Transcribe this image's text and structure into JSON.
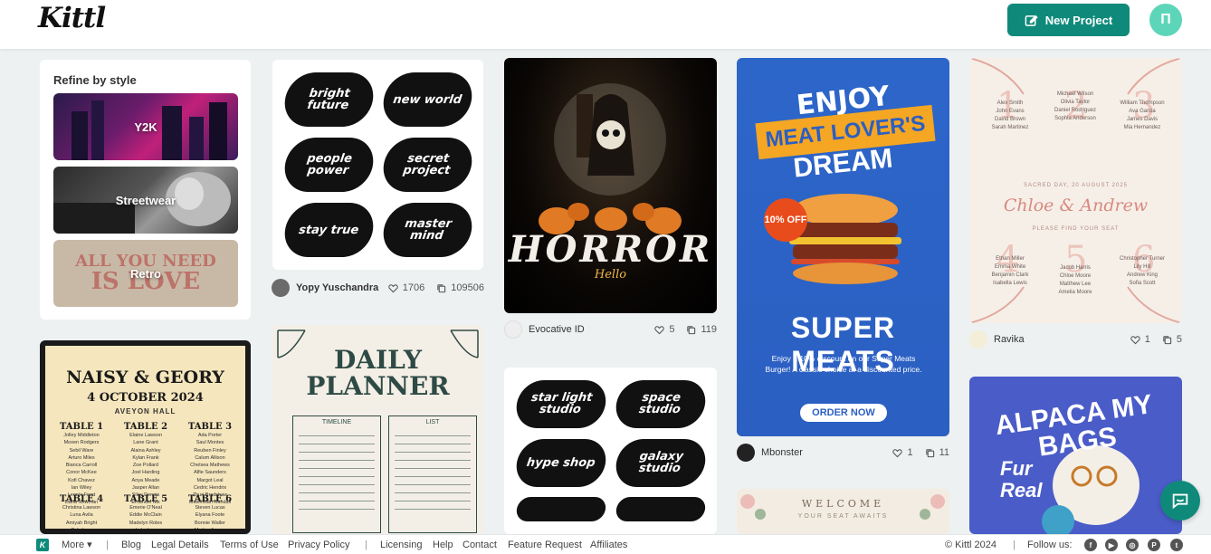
{
  "header": {
    "logo": "Kittl",
    "new_project_label": "New Project",
    "avatar_initial": "П"
  },
  "refine": {
    "title": "Refine by style",
    "styles": [
      {
        "label": "Y2K"
      },
      {
        "label": "Streetwear"
      },
      {
        "label": "Retro"
      }
    ],
    "retro_art_text": [
      "ALL YOU NEED",
      "IS LOVE"
    ]
  },
  "cards": {
    "bright_future": {
      "tiles": [
        "bright future",
        "new world",
        "people power",
        "secret project",
        "stay true",
        "master mind"
      ],
      "author": "Yopy Yuschandra",
      "likes": "1706",
      "copies": "109506"
    },
    "horror": {
      "title": "HORROR",
      "subtitle": "Hello",
      "author": "Evocative ID",
      "likes": "5",
      "copies": "119"
    },
    "meat": {
      "line1": "ENJOY",
      "line2": "MEAT LOVER'S",
      "line3": "DREAM",
      "badge": "10% OFF",
      "super": "SUPER MEATS",
      "desc": "Enjoy a 10% discount on our Super Meats Burger! A classic choice at a discounted price.",
      "button": "ORDER NOW",
      "author": "Mbonster",
      "likes": "1",
      "copies": "11"
    },
    "wedding": {
      "date": "SACRED DAY, 20 AUGUST 2025",
      "names": "Chloe & Andrew",
      "find": "PLEASE FIND YOUR SEAT",
      "nums": [
        "1",
        "2",
        "3",
        "4",
        "5",
        "6"
      ],
      "lists": [
        "Alex Smith\nJohn Evans\nDavid Brown\nSarah Martinez",
        "Michael Wilson\nOlivia Taylor\nDaniel Rodriguez\nSophia Anderson",
        "William Thompson\nAva Garcia\nJames Davis\nMia Hernandez",
        "Ethan Miller\nEmma White\nBenjamin Clark\nIsabella Lewis",
        "Jacob Harris\nChloe Moore\nMatthew Lee\nAmelia Moore",
        "Christopher Turner\nLily Hill\nAndrew King\nSofia Scott"
      ],
      "author": "Ravika",
      "likes": "1",
      "copies": "5"
    },
    "alpaca": {
      "title": "ALPACA MY BAGS",
      "fur": "Fur\nReal"
    },
    "naisy": {
      "title": "NAISY & GEORY",
      "date": "4 OCTOBER 2024",
      "hall": "AVEYON HALL",
      "tables": [
        {
          "t": "TABLE 1",
          "n": "Jolley Middleton\nMoxen Rodgers\nSebil Ware\nArturo Miles\nBianca Carroll\nConor McKee\nKofi Chavez\nIan Wiley\nLeonie Frost\nDarla Newman"
        },
        {
          "t": "TABLE 2",
          "n": "Elaine Lawson\nLane Grant\nAlaina Ashley\nKylan Frank\nZoe Pollard\nJoel Harding\nAnya Meade\nJasper Allan\nSiley Dennis\nEmanuel Nix"
        },
        {
          "t": "TABLE 3",
          "n": "Ada Porter\nSaul Montes\nReuben Finley\nCalum Allison\nChelsea Mathews\nAlfie Saunders\nMargot Leal\nCedric Hendrix\nZhuri Bradshaw\nMaximilian Randall"
        },
        {
          "t": "TABLE 4",
          "n": "Christina Lawson\nLuna Avila\nAmiyah Bright\nCole Lam\nMelissa Wright\nGrayson Pitts\nNoa Glenn"
        },
        {
          "t": "TABLE 5",
          "n": "Emerie O'Neal\nEddie McClain\nMadelyn Roles\nLuke Lee\nKarina Stevens\nZachary Loder\nAvani Walton"
        },
        {
          "t": "TABLE 6",
          "n": "Steven Lucas\nElyana Foote\nBonnie Waller\nMarlee Juarez\nJamel Liu\nPedro Hunt\nGenevieve Rojas"
        }
      ]
    },
    "planner": {
      "title": "DAILY\nPLANNER",
      "col1": "TIMELINE",
      "col2": "LIST"
    },
    "star_logos": {
      "tiles": [
        "star light studio",
        "space studio",
        "hype shop",
        "galaxy studio",
        "",
        ""
      ]
    },
    "welcome": {
      "title": "WELCOME",
      "sub": "YOUR SEAT AWAITS"
    }
  },
  "footer": {
    "more": "More ▾",
    "links": [
      "Blog",
      "Legal Details",
      "Terms of Use",
      "Privacy Policy",
      "Licensing",
      "Help",
      "Contact",
      "Feature Request",
      "Affiliates"
    ],
    "copyright": "© Kittl 2024",
    "follow": "Follow us:",
    "social_icons": [
      "facebook-icon",
      "youtube-icon",
      "instagram-icon",
      "pinterest-icon",
      "twitter-icon"
    ]
  },
  "colors": {
    "accent": "#0f8a7a",
    "avatar": "#5dd5b9",
    "meat_blue": "#2b5fc2",
    "meat_orange": "#f5a623",
    "alpaca_blue": "#4a5cc8"
  }
}
